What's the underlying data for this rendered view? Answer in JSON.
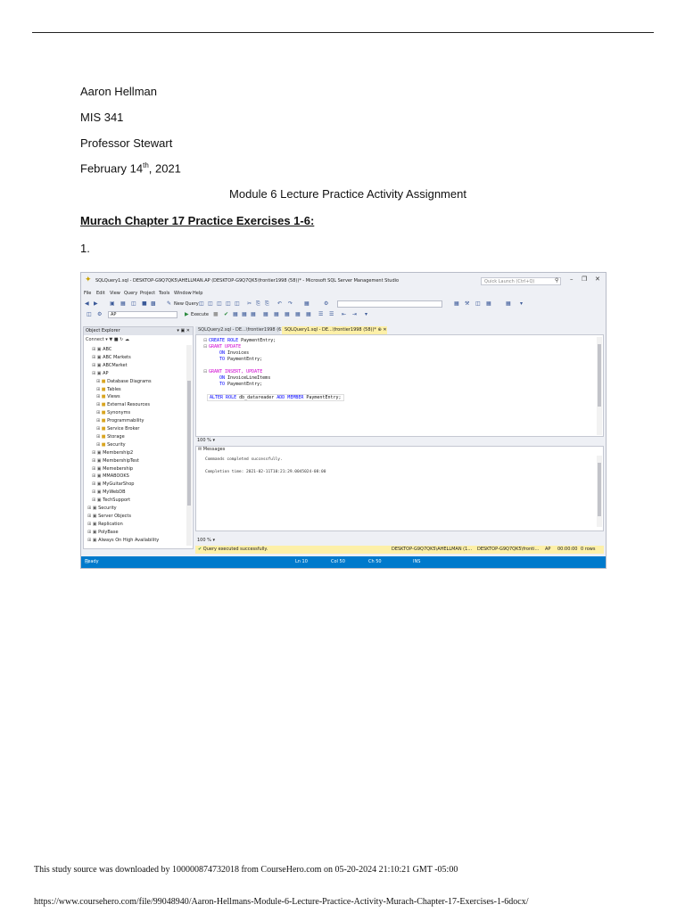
{
  "document": {
    "author": "Aaron Hellman",
    "course": "MIS 341",
    "professor": "Professor Stewart",
    "date_main": "February 14",
    "date_sup": "th",
    "date_year": ", 2021",
    "title": "Module 6 Lecture Practice Activity Assignment",
    "section_heading": "Murach Chapter 17 Practice Exercises 1-6:",
    "item_number": "1."
  },
  "ssms": {
    "window_title": "SQLQuery1.sql - DESKTOP-G9Q7QK5\\AHELLMAN.AP (DESKTOP-G9Q7QK5\\frontier1998 (58))* - Microsoft SQL Server Management Studio",
    "quick_launch_placeholder": "Quick Launch (Ctrl+Q)",
    "menu": [
      "File",
      "Edit",
      "View",
      "Query",
      "Project",
      "Tools",
      "Window",
      "Help"
    ],
    "toolbar": {
      "new_query_label": "New Query",
      "database_value": "AP",
      "execute_label": "Execute"
    },
    "object_explorer": {
      "title": "Object Explorer",
      "connect_label": "Connect",
      "items": [
        {
          "label": "ABC",
          "indent": 1
        },
        {
          "label": "ABC Markets",
          "indent": 1
        },
        {
          "label": "ABCMarket",
          "indent": 1
        },
        {
          "label": "AP",
          "indent": 1
        },
        {
          "label": "Database Diagrams",
          "indent": 2
        },
        {
          "label": "Tables",
          "indent": 2
        },
        {
          "label": "Views",
          "indent": 2
        },
        {
          "label": "External Resources",
          "indent": 2
        },
        {
          "label": "Synonyms",
          "indent": 2
        },
        {
          "label": "Programmability",
          "indent": 2
        },
        {
          "label": "Service Broker",
          "indent": 2
        },
        {
          "label": "Storage",
          "indent": 2
        },
        {
          "label": "Security",
          "indent": 2
        },
        {
          "label": "Membership2",
          "indent": 1
        },
        {
          "label": "MembershipTest",
          "indent": 1
        },
        {
          "label": "Memebership",
          "indent": 1
        },
        {
          "label": "MMABOOKS",
          "indent": 1
        },
        {
          "label": "MyGuitarShop",
          "indent": 1
        },
        {
          "label": "MyWebDB",
          "indent": 1
        },
        {
          "label": "TechSupport",
          "indent": 1
        },
        {
          "label": "Security",
          "indent": 0
        },
        {
          "label": "Server Objects",
          "indent": 0
        },
        {
          "label": "Replication",
          "indent": 0
        },
        {
          "label": "PolyBase",
          "indent": 0
        },
        {
          "label": "Always On High Availability",
          "indent": 0
        }
      ]
    },
    "tabs": {
      "inactive": "SQLQuery2.sql - DE...\\frontier1998 (62))*",
      "active": "SQLQuery1.sql - DE...\\frontier1998 (58))*"
    },
    "code": {
      "line1_kw": "CREATE ROLE",
      "line1_id": " PaymentEntry;",
      "line2_kw": "GRANT UPDATE",
      "line3_kw": "ON",
      "line3_id": " Invoices",
      "line4_kw": "TO",
      "line4_id": " PaymentEntry;",
      "line5_kw": "GRANT INSERT, UPDATE",
      "line6_kw": "ON",
      "line6_id": " InvoiceLineItems",
      "line7_kw": "TO",
      "line7_id": " PaymentEntry;",
      "line8_kw": "ALTER ROLE",
      "line8_id": " db_datareader ",
      "line8_kw2": "ADD MEMBER",
      "line8_id2": " PaymentEntry;"
    },
    "zoom": "100 %",
    "messages_tab": "Messages",
    "messages": {
      "line1": "Commands completed successfully.",
      "line2": "Completion time: 2021-02-11T10:21:29.0045024-08:00"
    },
    "exec_status": "Query executed successfully.",
    "exec_server": "DESKTOP-G9Q7QK5\\AHELLMAN (1...",
    "exec_login": "DESKTOP-G9Q7QK5\\fronti...",
    "exec_db": "AP",
    "exec_time": "00:00:00",
    "exec_rows": "0 rows",
    "status_bar": {
      "ready": "Ready",
      "ln": "Ln 10",
      "col": "Col 50",
      "ch": "Ch 50",
      "ins": "INS"
    }
  },
  "footer": {
    "source_line": "This study source was downloaded by 100000874732018 from CourseHero.com on 05-20-2024 21:10:21 GMT -05:00",
    "url_line": "https://www.coursehero.com/file/99048940/Aaron-Hellmans-Module-6-Lecture-Practice-Activity-Murach-Chapter-17-Exercises-1-6docx/"
  }
}
